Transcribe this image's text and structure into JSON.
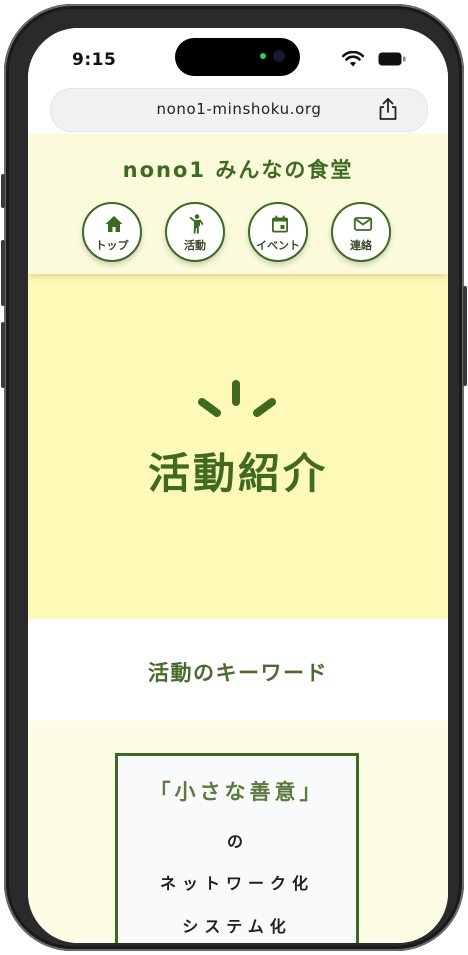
{
  "status_bar": {
    "time": "9:15"
  },
  "browser": {
    "url": "nono1-minshoku.org"
  },
  "site": {
    "title": "nono1 みんなの食堂"
  },
  "nav": [
    {
      "label": "トップ",
      "icon": "home-icon"
    },
    {
      "label": "活動",
      "icon": "person-walking-icon"
    },
    {
      "label": "イベント",
      "icon": "calendar-icon"
    },
    {
      "label": "連絡",
      "icon": "mail-icon"
    }
  ],
  "hero": {
    "title": "活動紹介"
  },
  "keywords": {
    "title": "活動のキーワード",
    "card": {
      "headline": "「小さな善意」",
      "line2": "の",
      "line3": "ネットワーク化",
      "line4": "システム化"
    }
  },
  "colors": {
    "brand_green": "#3d6a22",
    "header_bg": "#fbfbdc",
    "hero_bg": "#fdf9b6",
    "cream_bg": "#fdfce5"
  }
}
